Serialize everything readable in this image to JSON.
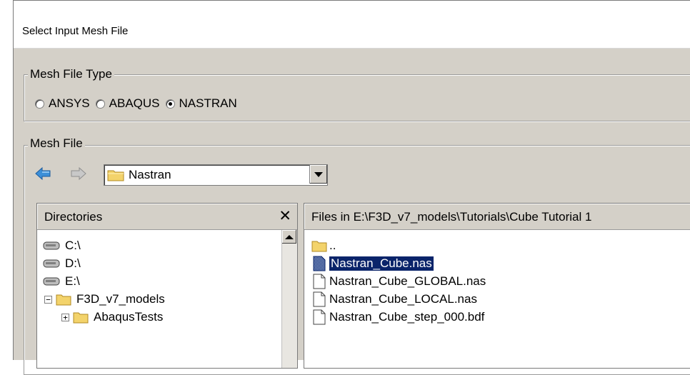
{
  "window": {
    "title": "Select Input Mesh File"
  },
  "mesh_file_type": {
    "legend": "Mesh File Type",
    "options": [
      {
        "label": "ANSYS",
        "checked": false
      },
      {
        "label": "ABAQUS",
        "checked": false
      },
      {
        "label": "NASTRAN",
        "checked": true
      }
    ]
  },
  "mesh_file": {
    "legend": "Mesh File",
    "nav": {
      "back_icon": "back-arrow-icon",
      "forward_icon": "forward-arrow-icon"
    },
    "folder_combo": {
      "value": "Nastran"
    }
  },
  "directories": {
    "header": "Directories",
    "close_glyph": "✕",
    "items": [
      {
        "label": "C:\\",
        "type": "drive"
      },
      {
        "label": "D:\\",
        "type": "drive"
      },
      {
        "label": "E:\\",
        "type": "drive"
      },
      {
        "label": "F3D_v7_models",
        "type": "folder",
        "expander": "−"
      },
      {
        "label": "AbaqusTests",
        "type": "folder",
        "expander": "+"
      }
    ]
  },
  "files": {
    "header": "Files in E:\\F3D_v7_models\\Tutorials\\Cube Tutorial 1",
    "items": [
      {
        "label": "..",
        "type": "folder"
      },
      {
        "label": "Nastran_Cube.nas",
        "type": "file",
        "selected": true
      },
      {
        "label": "Nastran_Cube_GLOBAL.nas",
        "type": "file"
      },
      {
        "label": "Nastran_Cube_LOCAL.nas",
        "type": "file"
      },
      {
        "label": "Nastran_Cube_step_000.bdf",
        "type": "file"
      }
    ]
  },
  "colors": {
    "dialog_bg": "#d4d0c8",
    "selection": "#0a246a",
    "folder": "#f3d36b",
    "arrow": "#3c8fd8"
  }
}
